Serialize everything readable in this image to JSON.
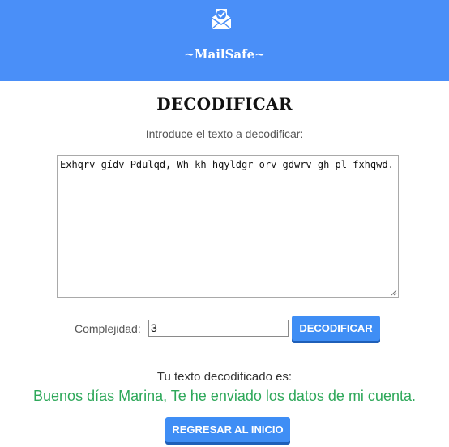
{
  "header": {
    "brand": "~MailSafe~",
    "logo_icon": "envelope-check-icon",
    "background_color": "#4a8ff8"
  },
  "main": {
    "title": "DECODIFICAR",
    "instruction": "Introduce el texto a decodificar:",
    "encoded_text": "Exhqrv gídv Pdulqd, Wh kh hqyldgr orv gdwrv gh pl fxhqwd.",
    "complexity_label": "Complejidad:",
    "complexity_value": "3",
    "decode_button": "DECODIFICAR",
    "result_label": "Tu texto decodificado es:",
    "result_text": "Buenos días Marina, Te he enviado los datos de mi cuenta.",
    "result_color": "#2ea85a",
    "home_button": "REGRESAR AL INICIO",
    "button_color": "#3f8ef5"
  }
}
